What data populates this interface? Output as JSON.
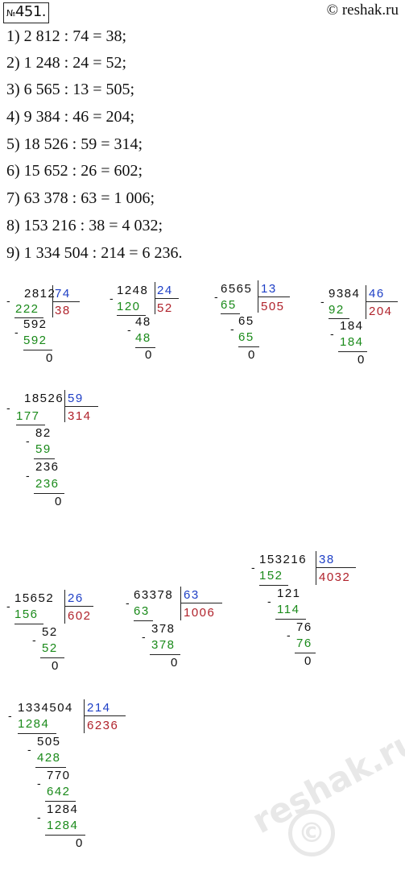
{
  "header": {
    "number_prefix": "№",
    "number": "451.",
    "source": "© reshak.ru"
  },
  "equations": [
    "1) 2 812 : 74 = 38;",
    "2) 1 248 : 24 = 52;",
    "3) 6 565 : 13 = 505;",
    "4) 9 384 : 46 = 204;",
    "5) 18 526 : 59 = 314;",
    "6) 15 652 : 26 = 602;",
    "7) 63 378 : 63 = 1 006;",
    "8) 153 216 : 38 = 4 032;",
    "9) 1 334 504 : 214 = 6 236."
  ],
  "divisions": [
    {
      "dividend": "2812",
      "divisor": "74",
      "quotient": "38",
      "rows": [
        "222",
        "592",
        "592",
        "0"
      ]
    },
    {
      "dividend": "1248",
      "divisor": "24",
      "quotient": "52",
      "rows": [
        "120",
        "48",
        "48",
        "0"
      ]
    },
    {
      "dividend": "6565",
      "divisor": "13",
      "quotient": "505",
      "rows": [
        "65",
        "65",
        "65",
        "0"
      ]
    },
    {
      "dividend": "9384",
      "divisor": "46",
      "quotient": "204",
      "rows": [
        "92",
        "184",
        "184",
        "0"
      ]
    },
    {
      "dividend": "18526",
      "divisor": "59",
      "quotient": "314",
      "rows": [
        "177",
        "82",
        "59",
        "236",
        "236",
        "0"
      ]
    },
    {
      "dividend": "15652",
      "divisor": "26",
      "quotient": "602",
      "rows": [
        "156",
        "52",
        "52",
        "0"
      ]
    },
    {
      "dividend": "63378",
      "divisor": "63",
      "quotient": "1006",
      "rows": [
        "63",
        "378",
        "378",
        "0"
      ]
    },
    {
      "dividend": "153216",
      "divisor": "38",
      "quotient": "4032",
      "rows": [
        "152",
        "121",
        "114",
        "76",
        "76",
        "0"
      ]
    },
    {
      "dividend": "1334504",
      "divisor": "214",
      "quotient": "6236",
      "rows": [
        "1284",
        "505",
        "428",
        "770",
        "642",
        "1284",
        "1284",
        "0"
      ]
    }
  ],
  "minus_sign": "-",
  "watermark": {
    "text": "reshak.ru",
    "symbol": "©"
  },
  "colors": {
    "subtrahend": "#1a8a1a",
    "divisor": "#1e3fc6",
    "quotient": "#b0222b",
    "text": "#111111"
  }
}
